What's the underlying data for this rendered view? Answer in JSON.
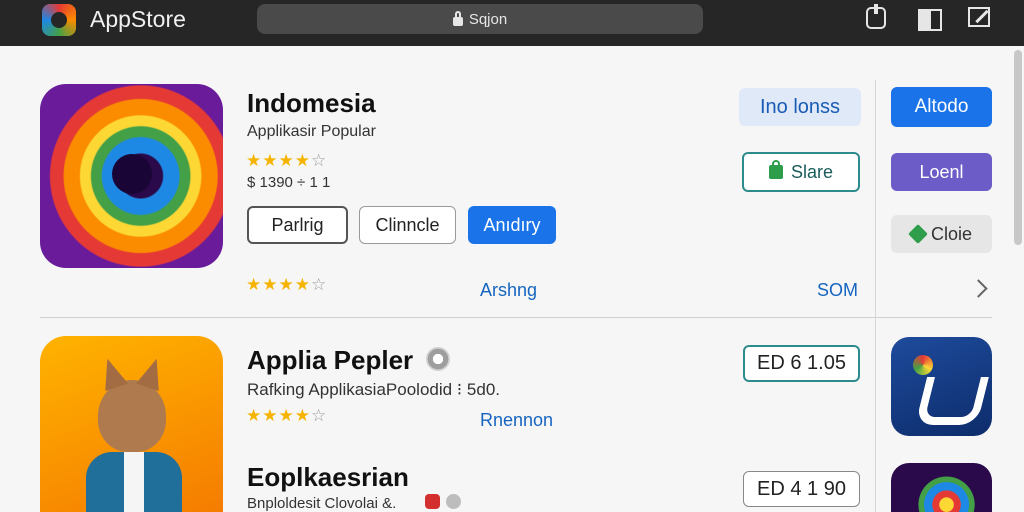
{
  "browser": {
    "app_name": "AppStore",
    "address": "Sqjon"
  },
  "featured": {
    "title": "Indomesia",
    "subtitle": "Applikasir Popular",
    "rating_stars": 4,
    "price": "$ 1390 ÷ 1 1",
    "buttons": {
      "primary_outline": "Parlrig",
      "secondary_outline": "Clinncle",
      "primary": "Anıdıry"
    },
    "bottom_rating_stars": 4,
    "link": "Arshng",
    "size_label": "SOM"
  },
  "featured_actions": {
    "info": "Ino lonss",
    "share": "Slare"
  },
  "side_actions": {
    "top": "Altodo",
    "login": "Loenl",
    "store": "Cloie"
  },
  "list": [
    {
      "title": "Applia Pepler",
      "subtitle": "Rafking ApplikasiaPoolodid ⁝ 5d0.",
      "rating_stars": 4,
      "link": "Rnennon",
      "price": "ED 6 1.05"
    },
    {
      "title": "Eoplkaesrian",
      "subtitle": "Bnploldesit Clovolai &.",
      "price": "ED 4 1 90"
    }
  ],
  "colors": {
    "topbar": "#262626",
    "accent_blue": "#1a73e8",
    "teal": "#2e8b8b",
    "purple": "#6b5cc7",
    "star": "#f5b400"
  }
}
